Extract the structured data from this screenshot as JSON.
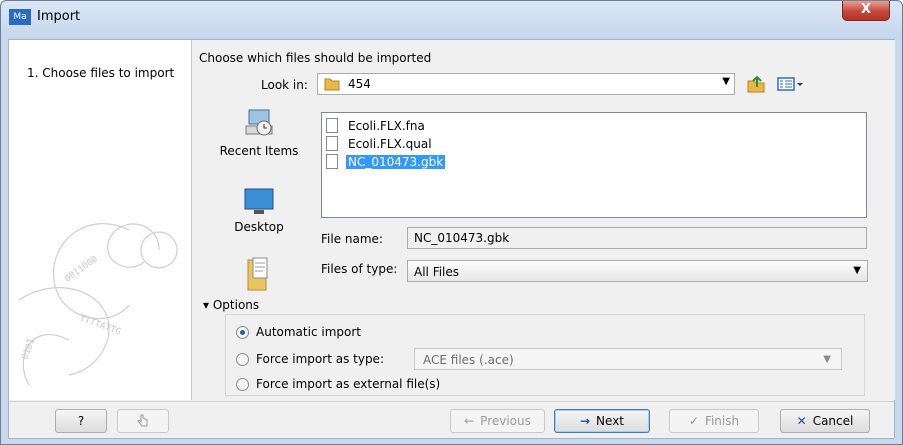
{
  "window": {
    "app_icon_text": "Ma",
    "title": "Import",
    "close_label": "X"
  },
  "wizard": {
    "steps": [
      "1.  Choose files to import"
    ]
  },
  "chooser": {
    "heading": "Choose which files should be imported",
    "look_in_label": "Look in:",
    "look_in_value": "454",
    "places": [
      {
        "label": "Recent Items",
        "icon": "recent-items-icon"
      },
      {
        "label": "Desktop",
        "icon": "desktop-icon"
      },
      {
        "label": "",
        "icon": "documents-icon"
      }
    ],
    "files": [
      {
        "name": "Ecoli.FLX.fna",
        "selected": false
      },
      {
        "name": "Ecoli.FLX.qual",
        "selected": false
      },
      {
        "name": "NC_010473.gbk",
        "selected": true
      }
    ],
    "file_name_label": "File name:",
    "file_name_value": "NC_010473.gbk",
    "files_of_type_label": "Files of type:",
    "files_of_type_value": "All Files"
  },
  "options": {
    "toggle_label": "Options",
    "automatic": "Automatic import",
    "force_type": "Force import as type:",
    "force_type_value": "ACE files (.ace)",
    "force_external": "Force import as external file(s)",
    "selected": "automatic"
  },
  "buttons": {
    "help": "?",
    "previous": "Previous",
    "next": "Next",
    "finish": "Finish",
    "cancel": "Cancel"
  },
  "colors": {
    "selection": "#3399ff",
    "close": "#c4483a"
  }
}
